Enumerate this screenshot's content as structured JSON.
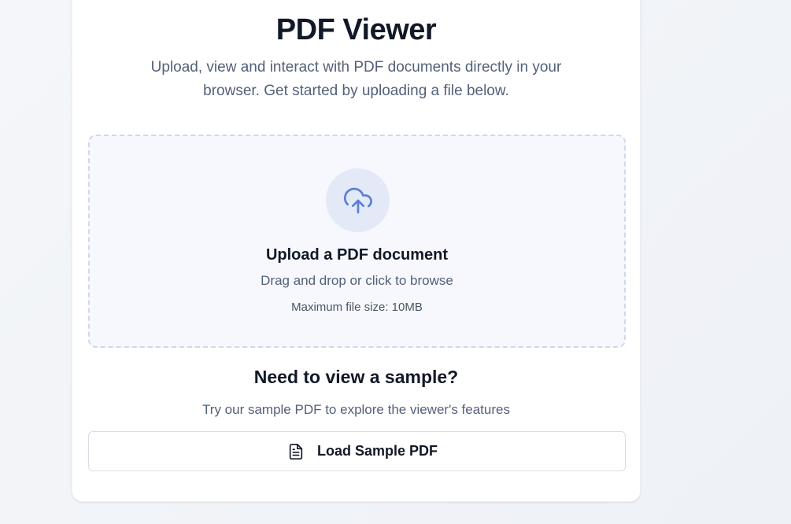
{
  "header": {
    "title": "PDF Viewer",
    "subtitle": "Upload, view and interact with PDF documents directly in your browser. Get started by uploading a file below."
  },
  "upload": {
    "icon": "cloud-upload-icon",
    "heading": "Upload a PDF document",
    "instruction": "Drag and drop or click to browse",
    "limit": "Maximum file size: 10MB"
  },
  "sample": {
    "heading": "Need to view a sample?",
    "description": "Try our sample PDF to explore the viewer's features",
    "button_icon": "file-text-icon",
    "button_label": "Load Sample PDF"
  },
  "colors": {
    "icon_accent": "#5b7fd6",
    "dropzone_border": "#cfd8ec",
    "dropzone_bg": "#f6f8fd"
  }
}
